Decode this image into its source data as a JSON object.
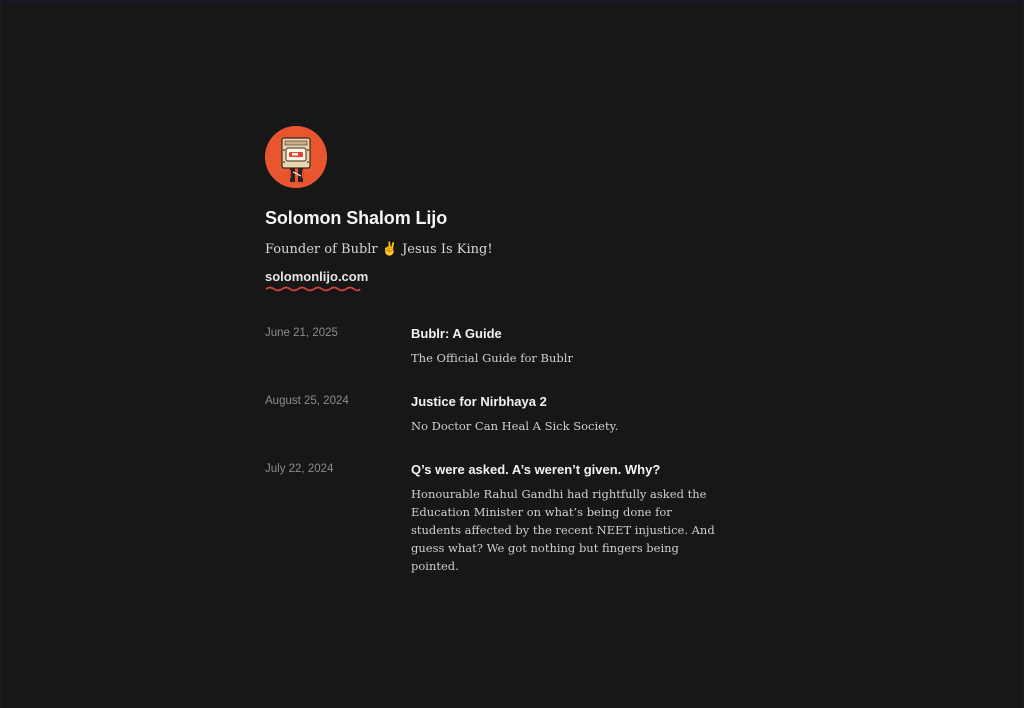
{
  "profile": {
    "name": "Solomon Shalom Lijo",
    "tagline": "Founder of Bublr ✌️ Jesus Is King!",
    "website": "solomonlijo.com",
    "avatar_icon": "robot-avatar-icon",
    "accent": "#e8562f"
  },
  "posts": [
    {
      "date": "June 21, 2025",
      "title": "Bublr: A Guide",
      "description": "The Official Guide for Bublr"
    },
    {
      "date": "August 25, 2024",
      "title": "Justice for Nirbhaya 2",
      "description": "No Doctor Can Heal A Sick Society."
    },
    {
      "date": "July 22, 2024",
      "title": "Q’s were asked. A’s weren’t given. Why?",
      "description": "Honourable Rahul Gandhi had rightfully asked the Education Minister on what’s being done for students affected by the recent NEET injustice. And guess what? We got nothing but fingers being pointed."
    }
  ],
  "colors": {
    "background": "#171717",
    "text": "#f2f2f2",
    "muted": "#8c8c8c",
    "link_underline": "#d9473b"
  }
}
